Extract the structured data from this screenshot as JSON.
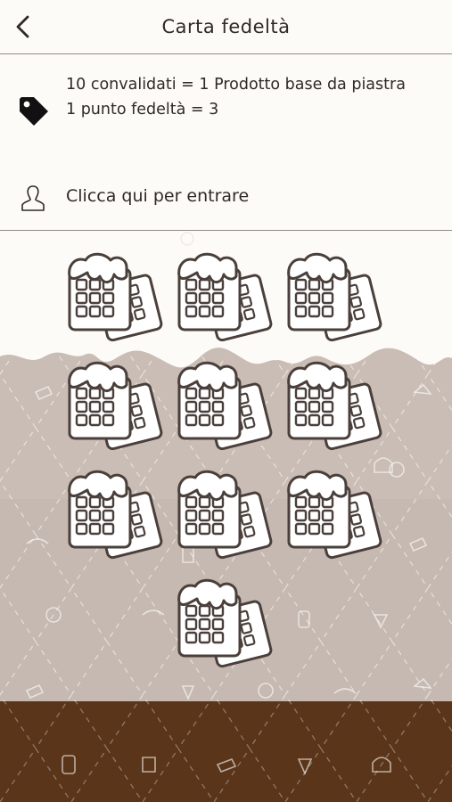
{
  "header": {
    "title": "Carta fedeltà",
    "back_icon": "chevron-left-icon"
  },
  "info": {
    "icon": "price-tag-icon",
    "line1": "10 convalidati = 1 Prodotto base da piastra",
    "line2": "1 punto fedeltà = 3"
  },
  "login": {
    "icon": "user-silhouette-icon",
    "label": "Clicca qui per entrare"
  },
  "stamps": {
    "icon": "waffle-icon",
    "count": 10,
    "collected": 0
  },
  "colors": {
    "background_top": "#fdfbf8",
    "milk_wave": "#c9bdb5",
    "chocolate_floor": "#5a3519",
    "stamp_outline": "#4a3f3a"
  }
}
